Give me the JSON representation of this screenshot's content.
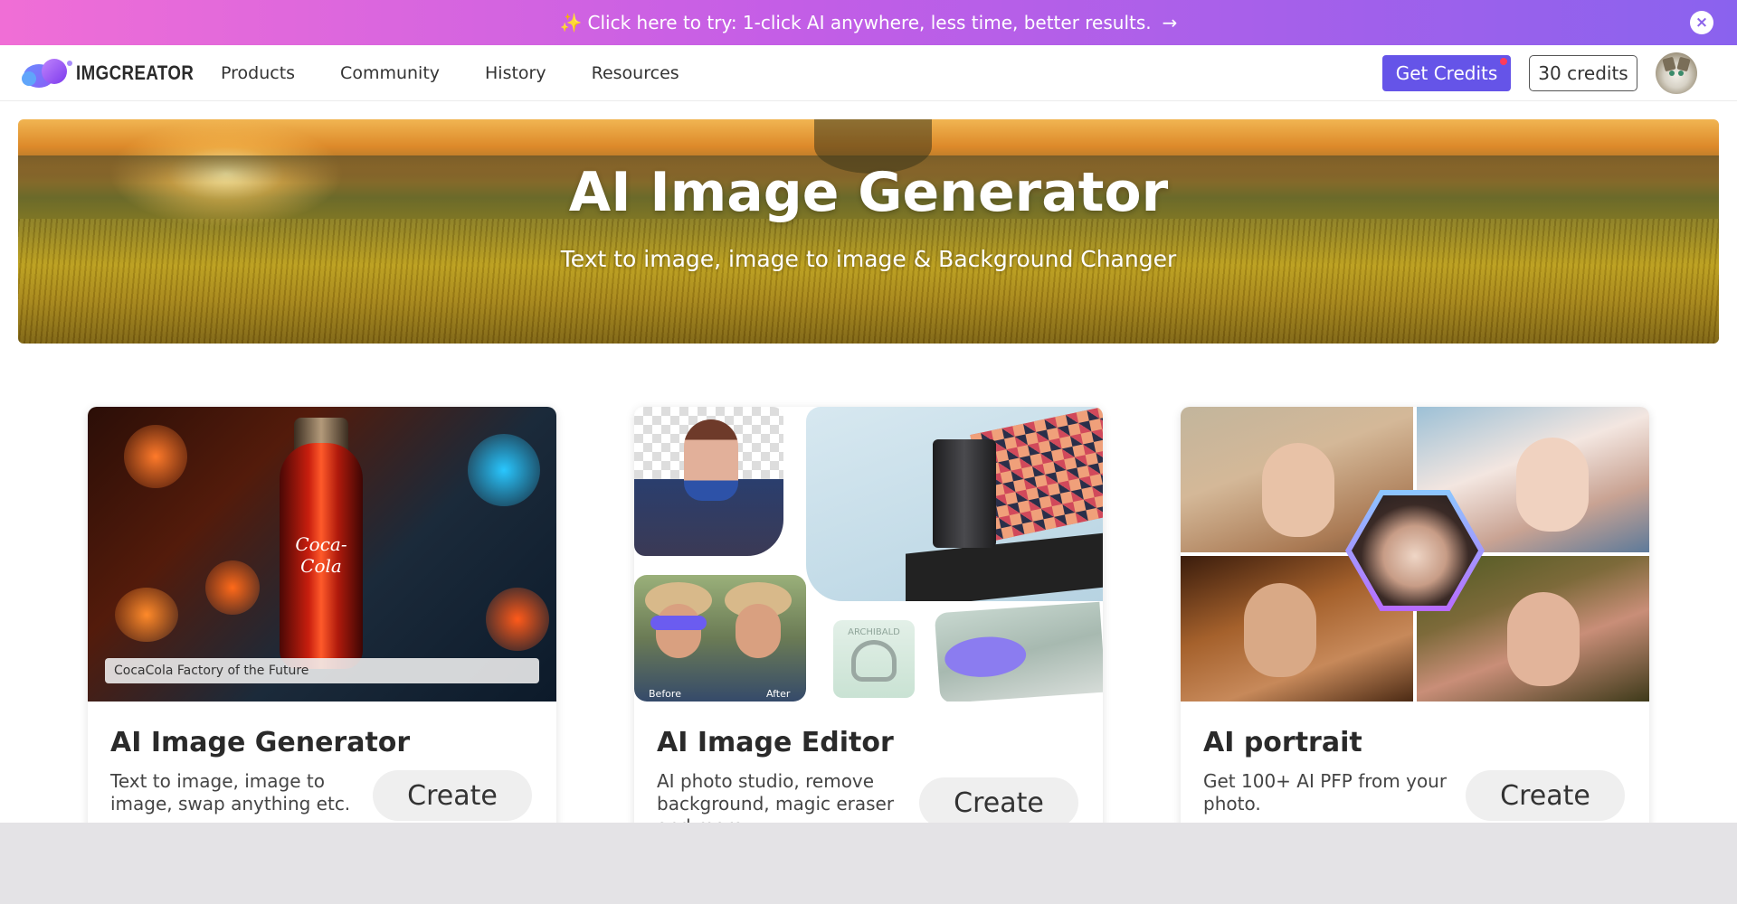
{
  "promo": {
    "spark": "✨",
    "text": "Click here to try: 1-click AI anywhere, less time, better results.",
    "arrow": "→",
    "close_icon": "×"
  },
  "nav": {
    "logo_text": "IMGCREATOR",
    "links": [
      "Products",
      "Community",
      "History",
      "Resources"
    ],
    "get_credits": "Get Credits",
    "credits_count": "30 credits"
  },
  "hero": {
    "title": "AI Image Generator",
    "subtitle": "Text to image, image to image & Background Changer"
  },
  "cards": [
    {
      "title": "AI Image Generator",
      "desc": "Text to image, image to image, swap anything etc.",
      "button": "Create",
      "image_caption": "CocaCola Factory of the Future",
      "image_brand": "Coca-Cola"
    },
    {
      "title": "AI Image Editor",
      "desc": "AI photo studio, remove background, magic eraser and more.",
      "button": "Create",
      "label_before": "Before",
      "label_after": "After",
      "label_brand": "ARCHIBALD"
    },
    {
      "title": "AI portrait",
      "desc": "Get 100+ AI PFP from your photo.",
      "button": "Create"
    }
  ],
  "colors": {
    "accent": "#6554e8",
    "promo_start": "#f06ed6",
    "promo_end": "#8a62ee"
  }
}
